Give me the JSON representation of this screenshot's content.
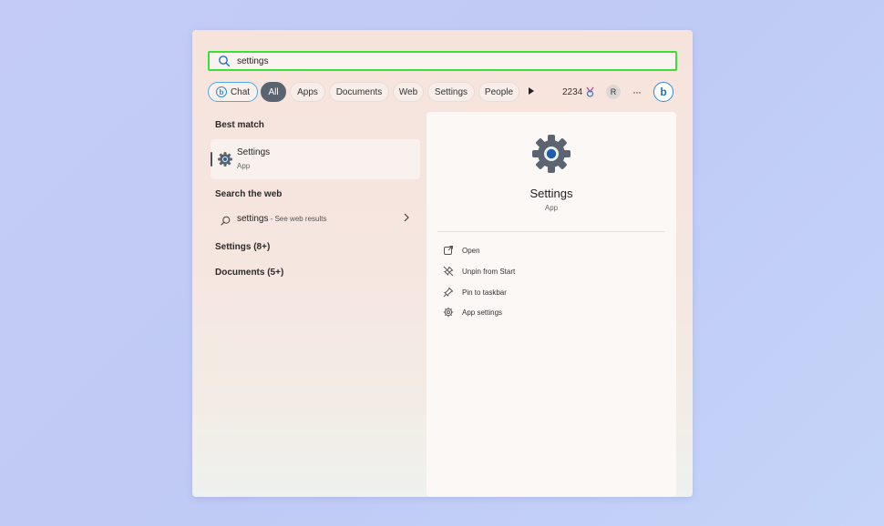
{
  "search": {
    "query": "settings"
  },
  "filters": {
    "chat": "Chat",
    "all": "All",
    "apps": "Apps",
    "documents": "Documents",
    "web": "Web",
    "settings": "Settings",
    "people": "People",
    "points": "2234",
    "avatar": "R",
    "more": "···",
    "bing": "b"
  },
  "best_match": {
    "title": "Best match",
    "app_name": "Settings",
    "app_type": "App"
  },
  "search_web": {
    "title": "Search the web",
    "query": "settings",
    "suffix": " - See web results"
  },
  "groups": {
    "settings": "Settings (8+)",
    "documents": "Documents (5+)"
  },
  "details": {
    "name": "Settings",
    "type": "App",
    "actions": {
      "open": "Open",
      "unpin_start": "Unpin from Start",
      "pin_taskbar": "Pin to taskbar",
      "app_settings": "App settings"
    }
  },
  "colors": {
    "highlight_border": "#38e038",
    "accent_blue": "#2d8ad8",
    "active_chip": "#5a6470"
  }
}
